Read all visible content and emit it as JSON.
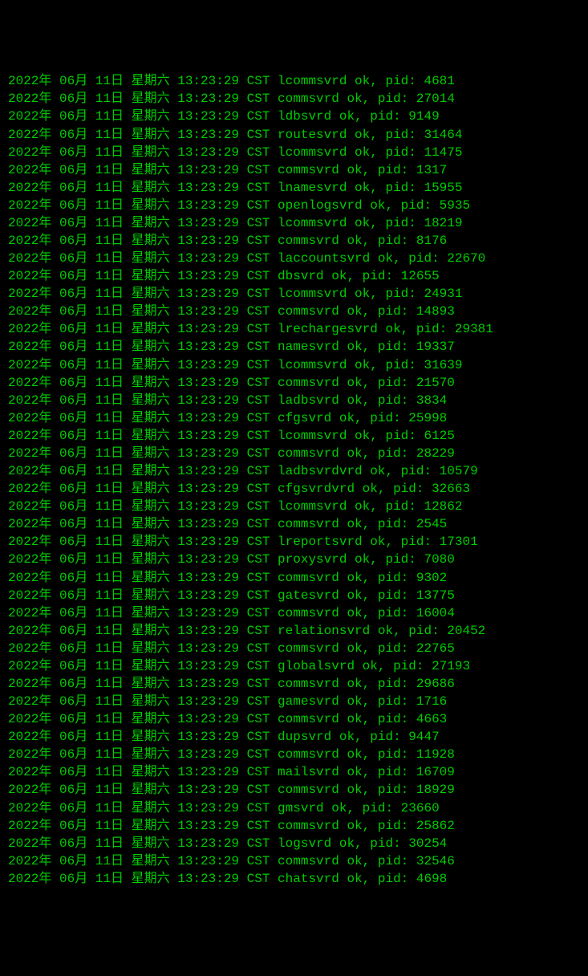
{
  "terminal": {
    "date_prefix": "2022年 06月 11日 星期六 13:23:29 CST",
    "lines": [
      {
        "service": "lcommsvrd",
        "pid": "4681"
      },
      {
        "service": "commsvrd",
        "pid": "27014"
      },
      {
        "service": "ldbsvrd",
        "pid": "9149"
      },
      {
        "service": "routesvrd",
        "pid": "31464"
      },
      {
        "service": "lcommsvrd",
        "pid": "11475"
      },
      {
        "service": "commsvrd",
        "pid": "1317"
      },
      {
        "service": "lnamesvrd",
        "pid": "15955"
      },
      {
        "service": "openlogsvrd",
        "pid": "5935"
      },
      {
        "service": "lcommsvrd",
        "pid": "18219"
      },
      {
        "service": "commsvrd",
        "pid": "8176"
      },
      {
        "service": "laccountsvrd",
        "pid": "22670"
      },
      {
        "service": "dbsvrd",
        "pid": "12655"
      },
      {
        "service": "lcommsvrd",
        "pid": "24931"
      },
      {
        "service": "commsvrd",
        "pid": "14893"
      },
      {
        "service": "lrechargesvrd",
        "pid": "29381"
      },
      {
        "service": "namesvrd",
        "pid": "19337"
      },
      {
        "service": "lcommsvrd",
        "pid": "31639"
      },
      {
        "service": "commsvrd",
        "pid": "21570"
      },
      {
        "service": "ladbsvrd",
        "pid": "3834"
      },
      {
        "service": "cfgsvrd",
        "pid": "25998"
      },
      {
        "service": "lcommsvrd",
        "pid": "6125"
      },
      {
        "service": "commsvrd",
        "pid": "28229"
      },
      {
        "service": "ladbsvrdvrd",
        "pid": "10579"
      },
      {
        "service": "cfgsvrdvrd",
        "pid": "32663"
      },
      {
        "service": "lcommsvrd",
        "pid": "12862"
      },
      {
        "service": "commsvrd",
        "pid": "2545"
      },
      {
        "service": "lreportsvrd",
        "pid": "17301"
      },
      {
        "service": "proxysvrd",
        "pid": "7080"
      },
      {
        "service": "commsvrd",
        "pid": "9302"
      },
      {
        "service": "gatesvrd",
        "pid": "13775"
      },
      {
        "service": "commsvrd",
        "pid": "16004"
      },
      {
        "service": "relationsvrd",
        "pid": "20452"
      },
      {
        "service": "commsvrd",
        "pid": "22765"
      },
      {
        "service": "globalsvrd",
        "pid": "27193"
      },
      {
        "service": "commsvrd",
        "pid": "29686"
      },
      {
        "service": "gamesvrd",
        "pid": "1716"
      },
      {
        "service": "commsvrd",
        "pid": "4663"
      },
      {
        "service": "dupsvrd",
        "pid": "9447"
      },
      {
        "service": "commsvrd",
        "pid": "11928"
      },
      {
        "service": "mailsvrd",
        "pid": "16709"
      },
      {
        "service": "commsvrd",
        "pid": "18929"
      },
      {
        "service": "gmsvrd",
        "pid": "23660"
      },
      {
        "service": "commsvrd",
        "pid": "25862"
      },
      {
        "service": "logsvrd",
        "pid": "30254"
      },
      {
        "service": "commsvrd",
        "pid": "32546"
      },
      {
        "service": "chatsvrd",
        "pid": "4698"
      }
    ]
  }
}
